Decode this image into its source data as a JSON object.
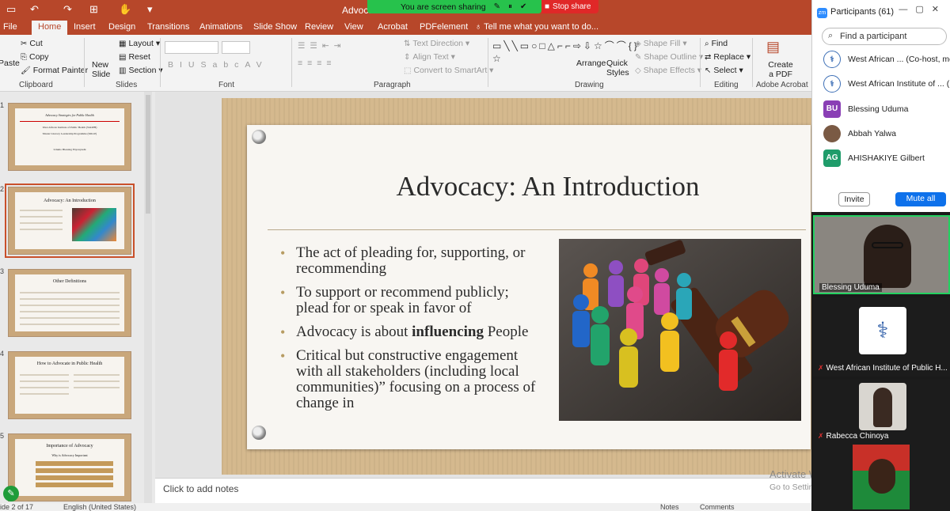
{
  "titlebar": {
    "doc_title": "Advoca",
    "sharing_text": "You are screen sharing",
    "stop_share": "Stop share"
  },
  "tabs": [
    "File",
    "Home",
    "Insert",
    "Design",
    "Transitions",
    "Animations",
    "Slide Show",
    "Review",
    "View",
    "Acrobat",
    "PDFelement"
  ],
  "tell_me": "Tell me what you want to do...",
  "ribbon": {
    "clipboard": {
      "paste": "Paste",
      "cut": "Cut",
      "copy": "Copy",
      "format_painter": "Format Painter",
      "label": "Clipboard"
    },
    "slides": {
      "new_slide": "New Slide",
      "layout": "Layout",
      "reset": "Reset",
      "section": "Section",
      "label": "Slides"
    },
    "font": {
      "label": "Font"
    },
    "paragraph": {
      "text_direction": "Text Direction",
      "align_text": "Align Text",
      "convert_smartart": "Convert to SmartArt",
      "label": "Paragraph"
    },
    "drawing": {
      "arrange": "Arrange",
      "quick_styles": "Quick Styles",
      "shape_fill": "Shape Fill",
      "shape_outline": "Shape Outline",
      "shape_effects": "Shape Effects",
      "label": "Drawing"
    },
    "editing": {
      "find": "Find",
      "replace": "Replace",
      "select": "Select",
      "label": "Editing"
    },
    "acrobat": {
      "create_pdf": "Create a PDF",
      "label": "Adobe Acrobat"
    }
  },
  "thumbnails": [
    {
      "num": "1",
      "title": "Advocacy Strategies for Public Health",
      "lines": [
        "West African Institute of Public Health (WAIPH)",
        "Master Literacy Leadership Programme (MLLP)",
        "Udumo Blessing Ebyonyushi"
      ]
    },
    {
      "num": "2",
      "title": "Advocacy: An Introduction"
    },
    {
      "num": "3",
      "title": "Other Definitions"
    },
    {
      "num": "4",
      "title": "How to Advocate in Public Health"
    },
    {
      "num": "5",
      "title": "Importance of Advocacy",
      "subtitle": "Why is Advocacy Important"
    }
  ],
  "slide": {
    "title": "Advocacy: An Introduction",
    "bullets": [
      {
        "text": "The act of pleading for, supporting, or recommending"
      },
      {
        "text": "To support or recommend publicly; plead for or speak in favor of"
      },
      {
        "pre": "Advocacy is about ",
        "bold": "influencing",
        "post": " People"
      },
      {
        "text": "Critical but constructive engagement with all stakeholders (including local communities)” focusing on a process of change in"
      }
    ]
  },
  "notes_placeholder": "Click to add notes",
  "status": {
    "slide": "ide 2 of 17",
    "language": "English (United States)",
    "notes": "Notes",
    "comments": "Comments"
  },
  "watermark": {
    "line1": "Activate Windows",
    "line2": "Go to Settings to activate Windows."
  },
  "zoom": {
    "title": "Participants (61)",
    "search_placeholder": "Find a participant",
    "participants": [
      {
        "name": "West African ... (Co-host, me)"
      },
      {
        "name": "West African Institute of ... (H"
      },
      {
        "initials": "BU",
        "name": "Blessing Uduma",
        "color": "#8a3fb5"
      },
      {
        "name": "Abbah Yalwa"
      },
      {
        "initials": "AG",
        "name": "AHISHAKIYE Gilbert",
        "color": "#1f9c6a"
      }
    ],
    "invite": "Invite",
    "mute_all": "Mute all",
    "videos": [
      {
        "name": "Blessing Uduma"
      },
      {
        "name": "West African Institute of Public H..."
      },
      {
        "name": "Rabecca Chinoya"
      }
    ]
  }
}
